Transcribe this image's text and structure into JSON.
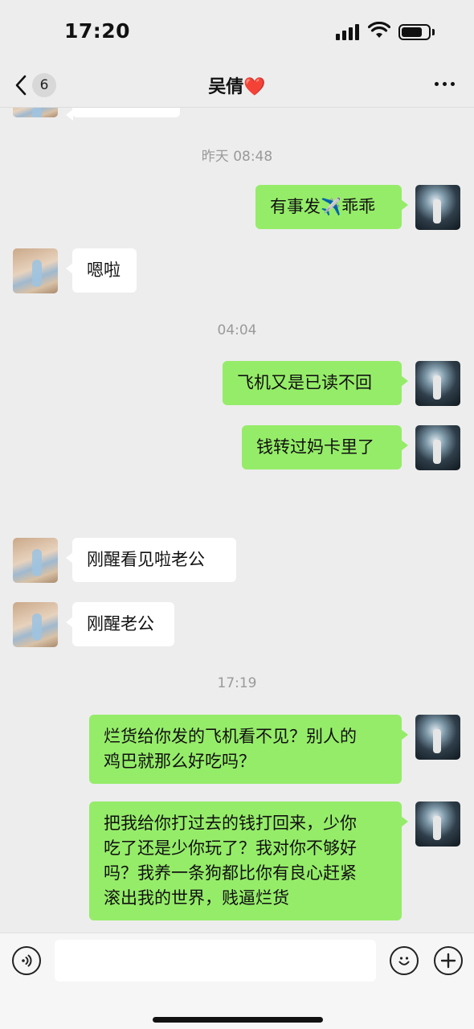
{
  "status_bar": {
    "time": "17:20"
  },
  "nav": {
    "back_count": "6",
    "title": "吴倩",
    "title_emoji": "❤️"
  },
  "chat": {
    "timestamps": [
      "昨天 08:48",
      "04:04",
      "17:19"
    ],
    "messages": [
      {
        "side": "self",
        "text": "有事发✈️乖乖"
      },
      {
        "side": "other",
        "text": "嗯啦"
      },
      {
        "side": "self",
        "text": "飞机又是已读不回"
      },
      {
        "side": "self",
        "text": "钱转过妈卡里了"
      },
      {
        "side": "other",
        "text": "刚醒看见啦老公"
      },
      {
        "side": "other",
        "text": "刚醒老公"
      },
      {
        "side": "self",
        "lines": [
          "烂货给你发的飞机看不见？别人的",
          "鸡巴就那么好吃吗？"
        ]
      },
      {
        "side": "self",
        "lines": [
          "把我给你打过去的钱打回来，少你",
          "吃了还是少你玩了？我对你不够好",
          "吗？我养一条狗都比你有良心赶紧",
          "滚出我的世界，贱逼烂货"
        ]
      }
    ]
  },
  "input_bar": {
    "placeholder": ""
  },
  "colors": {
    "self_bubble": "#95ec69",
    "other_bubble": "#ffffff",
    "background": "#ededed"
  }
}
